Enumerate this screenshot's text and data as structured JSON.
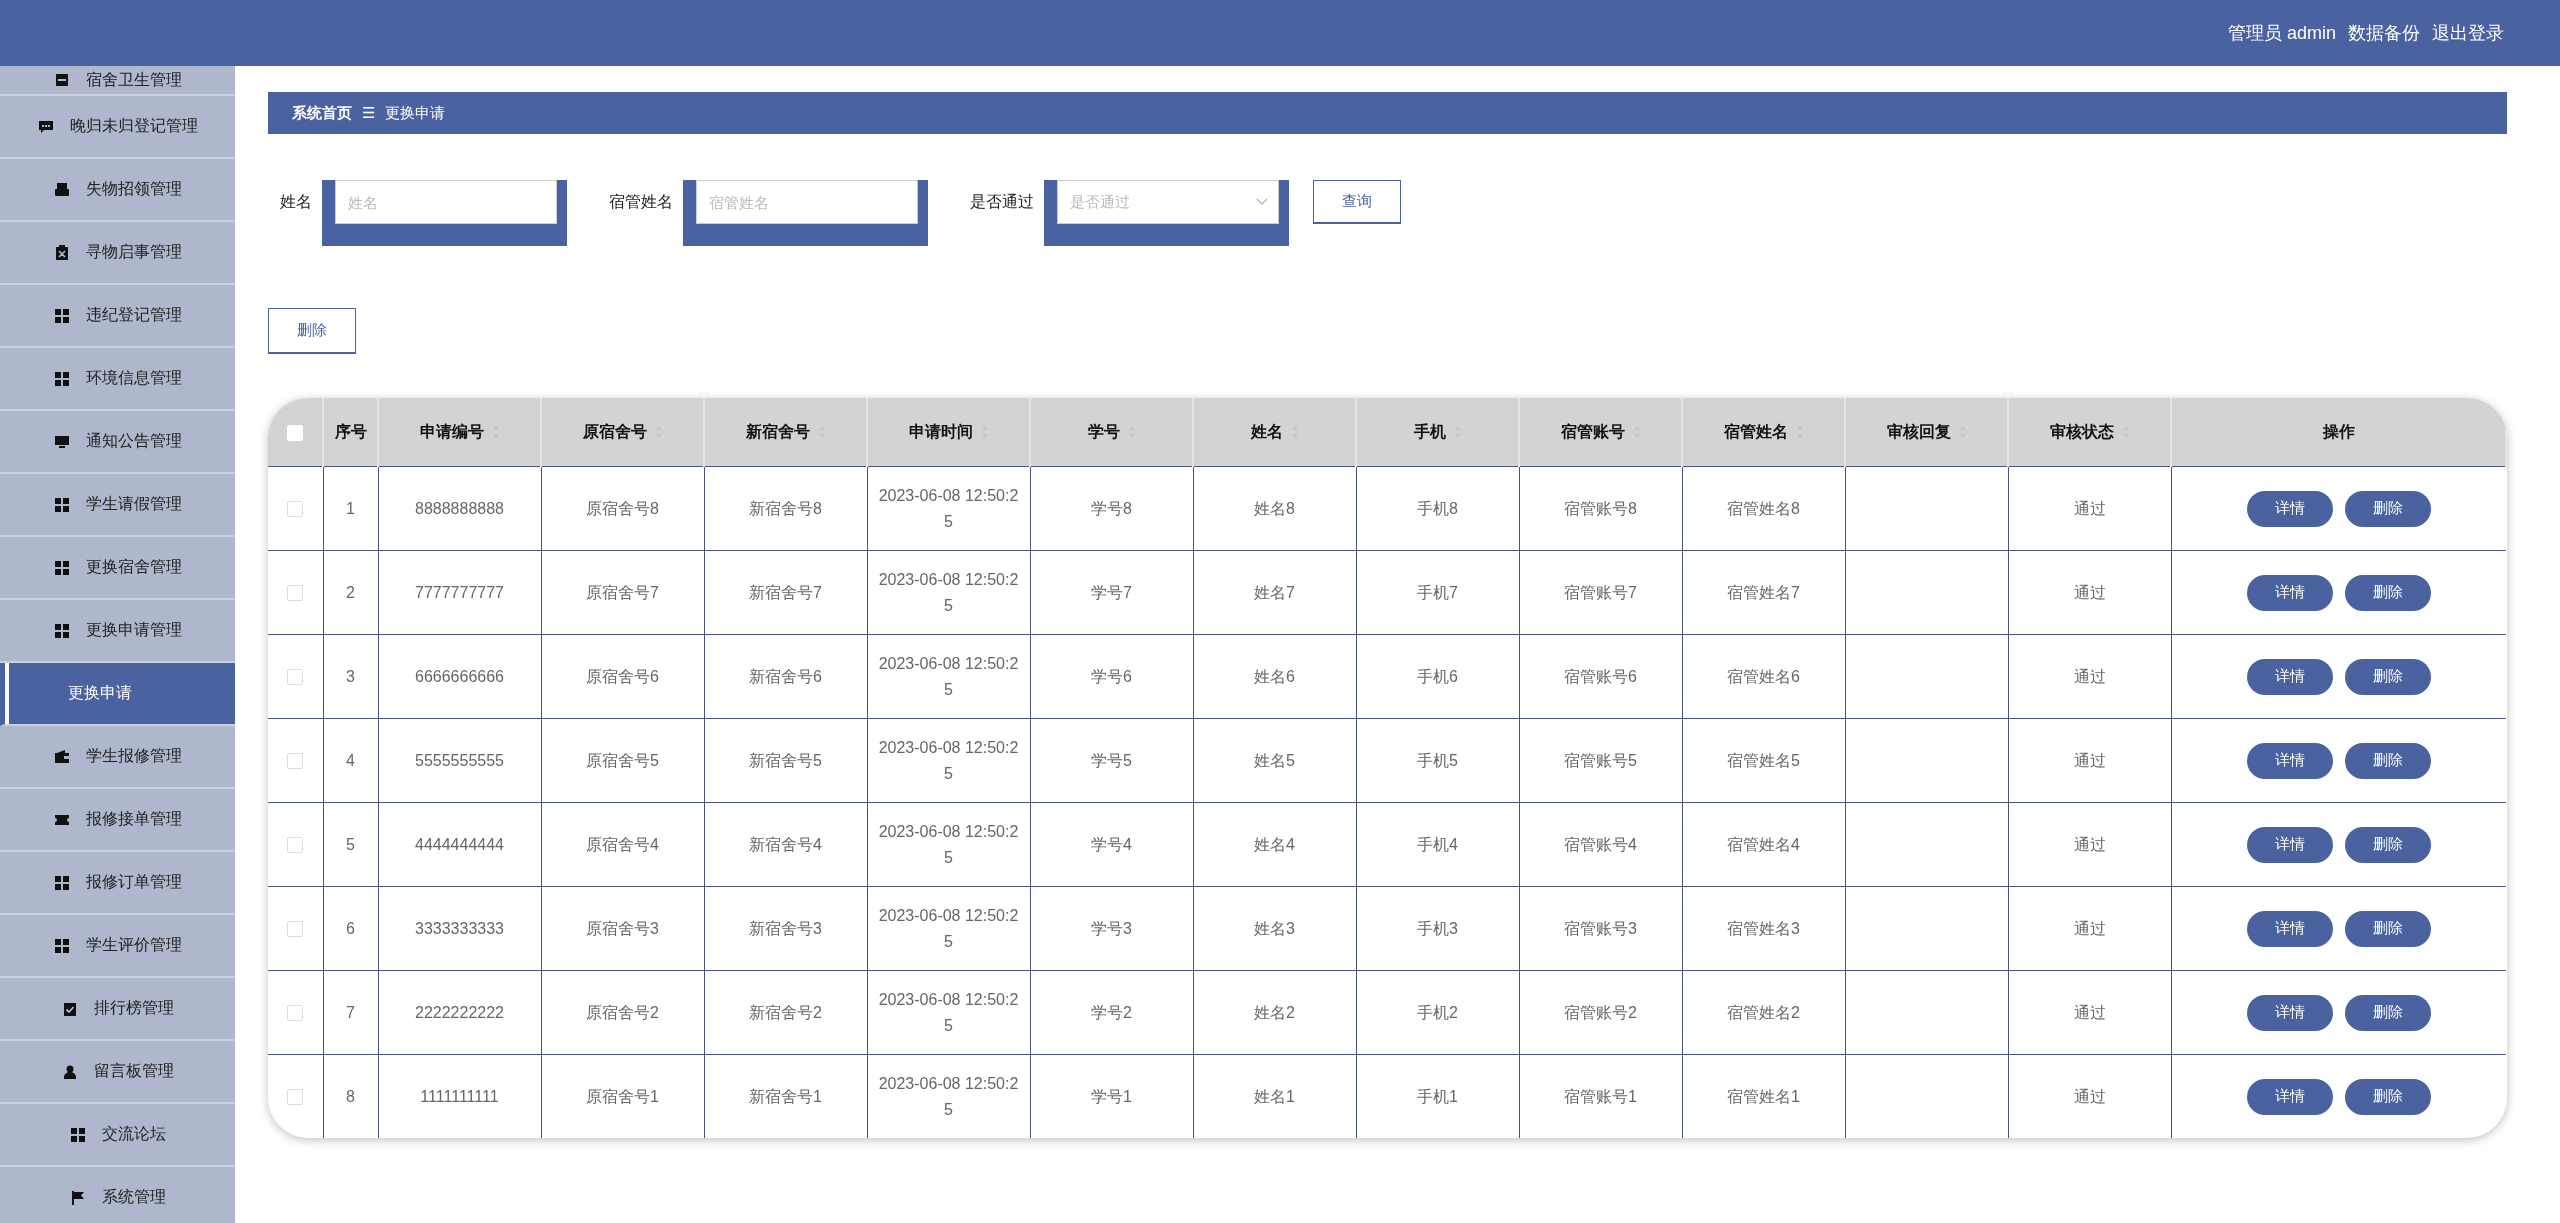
{
  "header": {
    "user_links": [
      "管理员 admin",
      "数据备份",
      "退出登录"
    ]
  },
  "sidebar": {
    "items": [
      {
        "label": "宿舍卫生管理",
        "selected": false
      },
      {
        "label": "晚归未归登记管理",
        "selected": false
      },
      {
        "label": "失物招领管理",
        "selected": false
      },
      {
        "label": "寻物启事管理",
        "selected": false
      },
      {
        "label": "违纪登记管理",
        "selected": false
      },
      {
        "label": "环境信息管理",
        "selected": false
      },
      {
        "label": "通知公告管理",
        "selected": false
      },
      {
        "label": "学生请假管理",
        "selected": false
      },
      {
        "label": "更换宿舍管理",
        "selected": false
      },
      {
        "label": "更换申请管理",
        "selected": false,
        "children": [
          {
            "label": "更换申请",
            "selected": true
          }
        ]
      },
      {
        "label": "学生报修管理",
        "selected": false
      },
      {
        "label": "报修接单管理",
        "selected": false
      },
      {
        "label": "报修订单管理",
        "selected": false
      },
      {
        "label": "学生评价管理",
        "selected": false
      },
      {
        "label": "排行榜管理",
        "selected": false
      },
      {
        "label": "留言板管理",
        "selected": false
      },
      {
        "label": "交流论坛",
        "selected": false
      },
      {
        "label": "系统管理",
        "selected": false
      }
    ]
  },
  "breadcrumb": {
    "home": "系统首页",
    "separator": "☰",
    "current": "更换申请"
  },
  "search": {
    "fields": [
      {
        "kind": "text",
        "label": "姓名",
        "placeholder": "姓名"
      },
      {
        "kind": "text",
        "label": "宿管姓名",
        "placeholder": "宿管姓名"
      },
      {
        "kind": "select",
        "label": "是否通过",
        "placeholder": "是否通过"
      }
    ],
    "button": "查询"
  },
  "actions": {
    "delete_button": "删除"
  },
  "table": {
    "select_all": {
      "checked": false
    },
    "columns": [
      {
        "label": "序号",
        "sortable": false
      },
      {
        "label": "申请编号",
        "sortable": true
      },
      {
        "label": "原宿舍号",
        "sortable": true
      },
      {
        "label": "新宿舍号",
        "sortable": true
      },
      {
        "label": "申请时间",
        "sortable": true
      },
      {
        "label": "学号",
        "sortable": true
      },
      {
        "label": "姓名",
        "sortable": true
      },
      {
        "label": "手机",
        "sortable": true
      },
      {
        "label": "宿管账号",
        "sortable": true
      },
      {
        "label": "宿管姓名",
        "sortable": true
      },
      {
        "label": "审核回复",
        "sortable": true
      },
      {
        "label": "审核状态",
        "sortable": true
      },
      {
        "label": "操作",
        "sortable": false
      }
    ],
    "rows": [
      {
        "checked": false,
        "cells": [
          "1",
          "8888888888",
          "原宿舍号8",
          "新宿舍号8",
          "2023-06-08 12:50:25",
          "学号8",
          "姓名8",
          "手机8",
          "宿管账号8",
          "宿管姓名8",
          "",
          "通过"
        ],
        "buttons": [
          "详情",
          "删除"
        ]
      },
      {
        "checked": false,
        "cells": [
          "2",
          "7777777777",
          "原宿舍号7",
          "新宿舍号7",
          "2023-06-08 12:50:25",
          "学号7",
          "姓名7",
          "手机7",
          "宿管账号7",
          "宿管姓名7",
          "",
          "通过"
        ],
        "buttons": [
          "详情",
          "删除"
        ]
      },
      {
        "checked": false,
        "cells": [
          "3",
          "6666666666",
          "原宿舍号6",
          "新宿舍号6",
          "2023-06-08 12:50:25",
          "学号6",
          "姓名6",
          "手机6",
          "宿管账号6",
          "宿管姓名6",
          "",
          "通过"
        ],
        "buttons": [
          "详情",
          "删除"
        ]
      },
      {
        "checked": false,
        "cells": [
          "4",
          "5555555555",
          "原宿舍号5",
          "新宿舍号5",
          "2023-06-08 12:50:25",
          "学号5",
          "姓名5",
          "手机5",
          "宿管账号5",
          "宿管姓名5",
          "",
          "通过"
        ],
        "buttons": [
          "详情",
          "删除"
        ]
      },
      {
        "checked": false,
        "cells": [
          "5",
          "4444444444",
          "原宿舍号4",
          "新宿舍号4",
          "2023-06-08 12:50:25",
          "学号4",
          "姓名4",
          "手机4",
          "宿管账号4",
          "宿管姓名4",
          "",
          "通过"
        ],
        "buttons": [
          "详情",
          "删除"
        ]
      },
      {
        "checked": false,
        "cells": [
          "6",
          "3333333333",
          "原宿舍号3",
          "新宿舍号3",
          "2023-06-08 12:50:25",
          "学号3",
          "姓名3",
          "手机3",
          "宿管账号3",
          "宿管姓名3",
          "",
          "通过"
        ],
        "buttons": [
          "详情",
          "删除"
        ]
      },
      {
        "checked": false,
        "cells": [
          "7",
          "2222222222",
          "原宿舍号2",
          "新宿舍号2",
          "2023-06-08 12:50:25",
          "学号2",
          "姓名2",
          "手机2",
          "宿管账号2",
          "宿管姓名2",
          "",
          "通过"
        ],
        "buttons": [
          "详情",
          "删除"
        ]
      },
      {
        "checked": false,
        "cells": [
          "8",
          "1111111111",
          "原宿舍号1",
          "新宿舍号1",
          "2023-06-08 12:50:25",
          "学号1",
          "姓名1",
          "手机1",
          "宿管账号1",
          "宿管姓名1",
          "",
          "通过"
        ],
        "buttons": [
          "详情",
          "删除"
        ]
      }
    ]
  }
}
